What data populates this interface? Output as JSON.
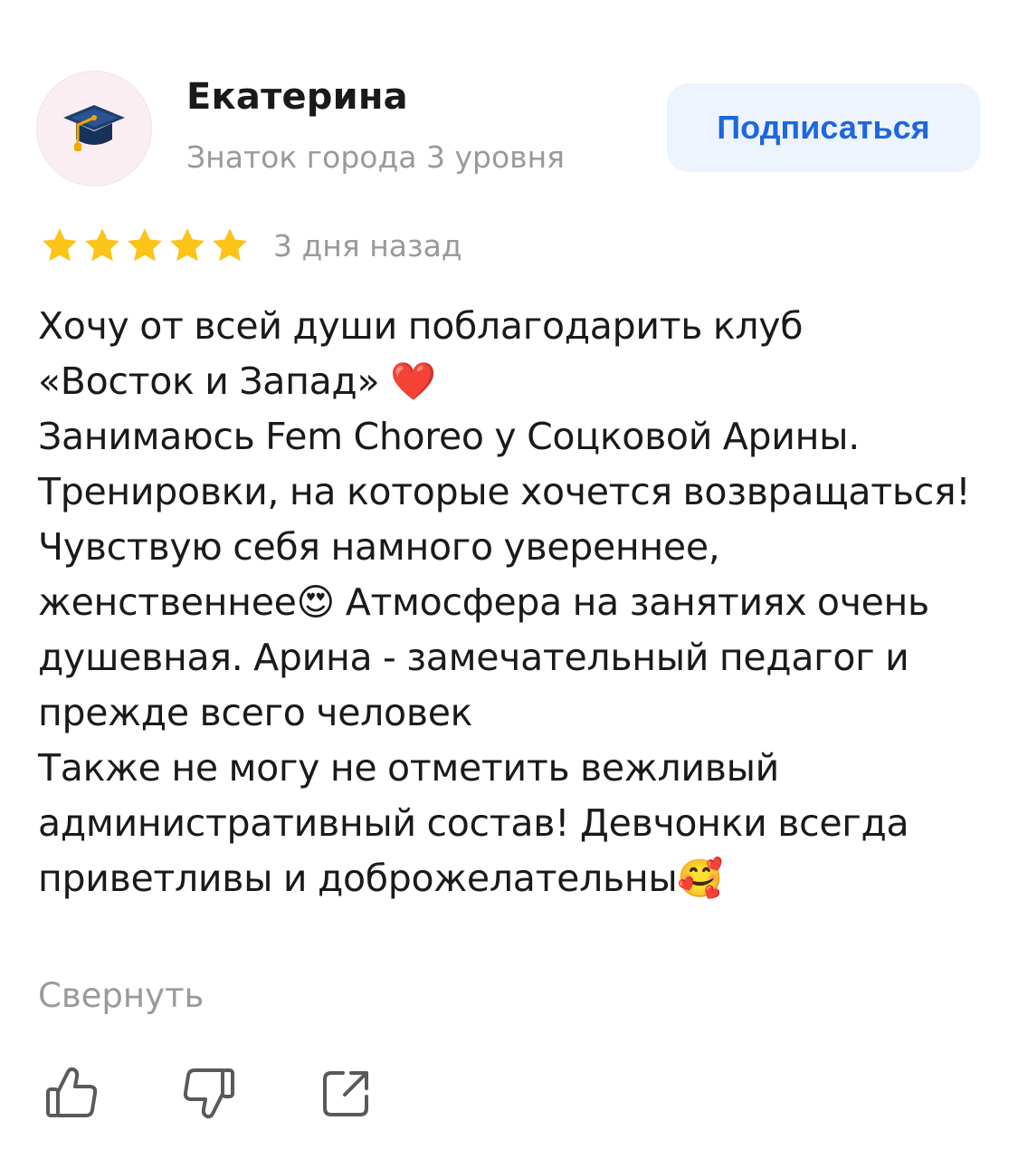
{
  "author": {
    "name": "Екатерина",
    "level": "Знаток города 3 уровня",
    "avatar_icon": "graduation-cap-icon"
  },
  "subscribe": {
    "label": "Подписаться",
    "color": "#1d67e0",
    "background": "#eef4fe"
  },
  "rating": {
    "stars": 5,
    "max": 5,
    "star_color": "#fcc419"
  },
  "review": {
    "date": "3 дня назад",
    "text": "Хочу от всей души поблагодарить клуб\n«Восток и Запад» ❤️\nЗанимаюсь Fem Choreo у Соцковой Арины. Тренировки, на которые хочется возвращаться! Чувствую себя намного увереннее, женственнее😍 Атмосфера на занятиях очень душевная. Арина - замечательный педагог и прежде всего человек\nТакже не могу не отметить вежливый административный состав! Девчонки всегда приветливы и доброжелательны🥰",
    "collapse_label": "Свернуть"
  },
  "actions": [
    {
      "icon": "thumbs-up-icon"
    },
    {
      "icon": "thumbs-down-icon"
    },
    {
      "icon": "share-icon"
    }
  ]
}
